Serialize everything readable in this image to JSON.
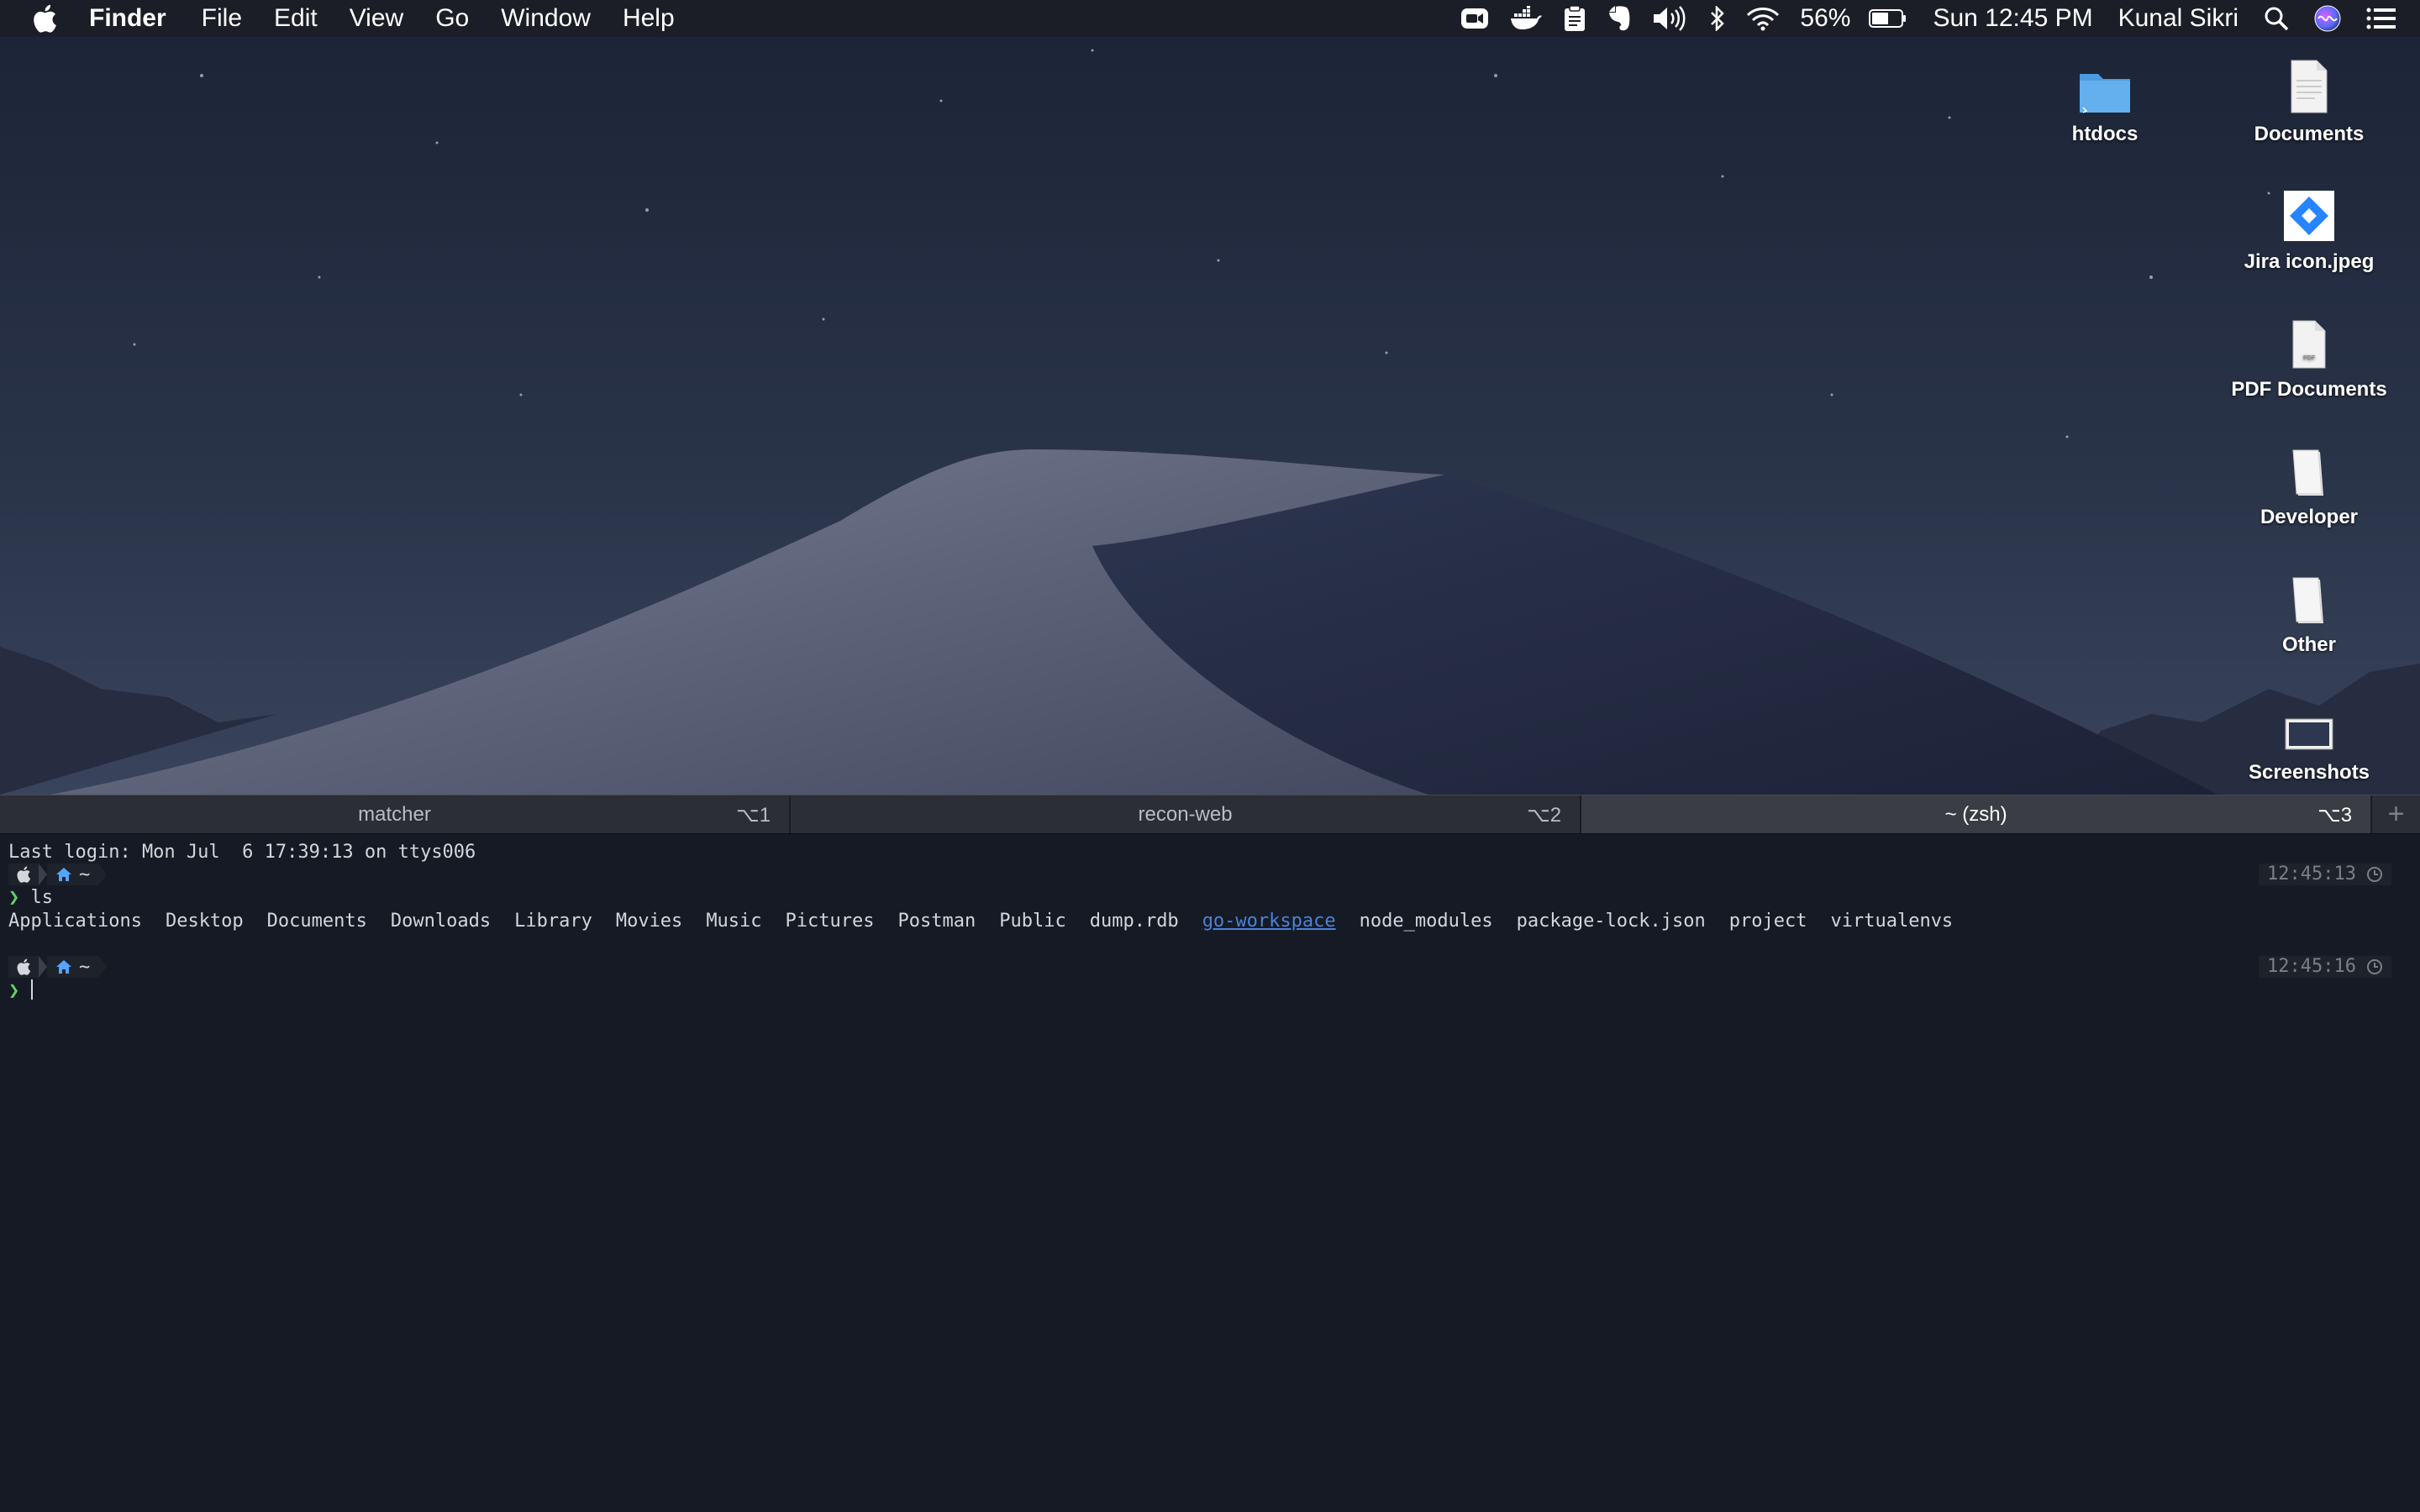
{
  "menubar": {
    "app": "Finder",
    "items": [
      "File",
      "Edit",
      "View",
      "Go",
      "Window",
      "Help"
    ],
    "battery": "56%",
    "clock": "Sun 12:45 PM",
    "user": "Kunal Sikri",
    "status_icons": [
      "zoom-icon",
      "docker-icon",
      "clipboard-icon",
      "evernote-icon",
      "volume-icon",
      "bluetooth-icon",
      "wifi-icon",
      "battery-icon",
      "spotlight-icon",
      "siri-icon",
      "notification-center-icon"
    ]
  },
  "desktop_icons": [
    {
      "label": "htdocs",
      "icon": "folder-icon"
    },
    {
      "label": "Documents",
      "icon": "document-icon"
    },
    {
      "label": "Jira icon.jpeg",
      "icon": "jira-icon"
    },
    {
      "label": "PDF Documents",
      "icon": "pdf-icon"
    },
    {
      "label": "Developer",
      "icon": "stack-icon"
    },
    {
      "label": "Other",
      "icon": "stack-icon"
    },
    {
      "label": "Screenshots",
      "icon": "screenshot-icon"
    }
  ],
  "terminal": {
    "tabs": [
      {
        "title": "matcher",
        "shortcut": "⌥1"
      },
      {
        "title": "recon-web",
        "shortcut": "⌥2"
      },
      {
        "title": "~ (zsh)",
        "shortcut": "⌥3"
      }
    ],
    "add_tab": "+",
    "last_login": "Last login: Mon Jul  6 17:39:13 on ttys006",
    "prompt_dir": "~",
    "prompt_char": "❯",
    "command1": "ls",
    "timestamp1": "12:45:13",
    "timestamp2": "12:45:16",
    "ls_output": [
      "Applications",
      "Desktop",
      "Documents",
      "Downloads",
      "Library",
      "Movies",
      "Music",
      "Pictures",
      "Postman",
      "Public",
      "dump.rdb",
      "go-workspace",
      "node_modules",
      "package-lock.json",
      "project",
      "virtualenvs"
    ],
    "ls_link_item": "go-workspace",
    "colors": {
      "background": "#151a24",
      "prompt": "#5fd35f",
      "home": "#55a4ff",
      "link": "#4b82d6"
    }
  }
}
